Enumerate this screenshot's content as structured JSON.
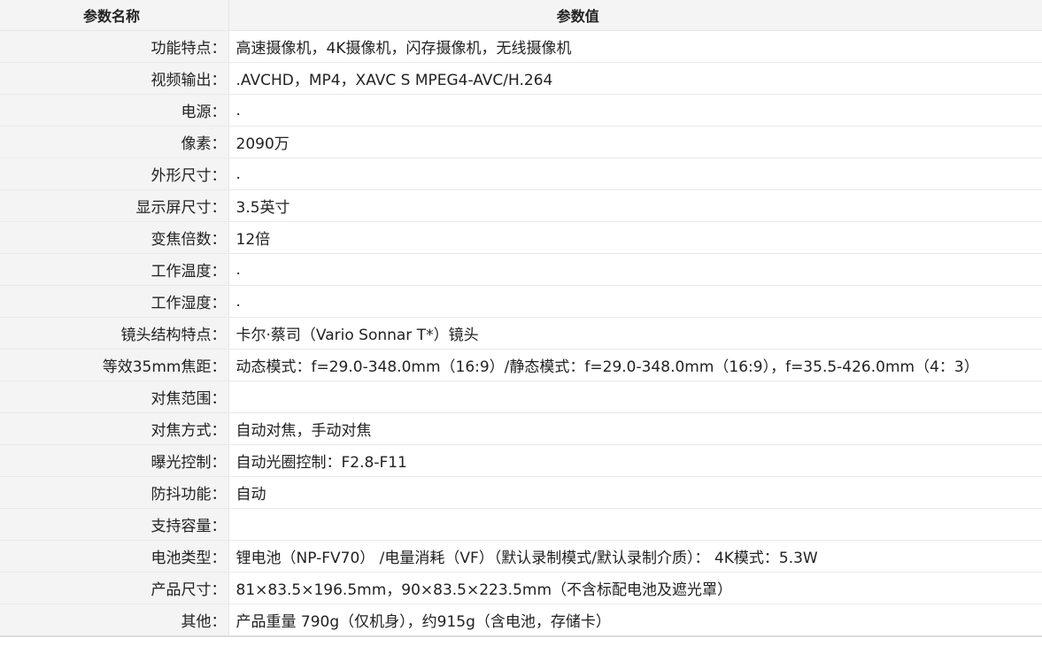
{
  "header": {
    "name_label": "参数名称",
    "value_label": "参数值"
  },
  "rows": [
    {
      "label": "功能特点：",
      "value": "高速摄像机，4K摄像机，闪存摄像机，无线摄像机"
    },
    {
      "label": "视频输出：",
      "value": ".AVCHD，MP4，XAVC S MPEG4-AVC/H.264"
    },
    {
      "label": "电源：",
      "value": "."
    },
    {
      "label": "像素：",
      "value": "2090万"
    },
    {
      "label": "外形尺寸：",
      "value": "."
    },
    {
      "label": "显示屏尺寸：",
      "value": "3.5英寸"
    },
    {
      "label": "变焦倍数：",
      "value": "12倍"
    },
    {
      "label": "工作温度：",
      "value": "."
    },
    {
      "label": "工作湿度：",
      "value": "."
    },
    {
      "label": "镜头结构特点：",
      "value": "卡尔·蔡司（Vario Sonnar T*）镜头"
    },
    {
      "label": "等效35mm焦距：",
      "value": "动态模式：f=29.0-348.0mm（16:9）/静态模式：f=29.0-348.0mm（16:9），f=35.5-426.0mm（4：3）"
    },
    {
      "label": "对焦范围：",
      "value": ""
    },
    {
      "label": "对焦方式：",
      "value": "自动对焦，手动对焦"
    },
    {
      "label": "曝光控制：",
      "value": "自动光圈控制：F2.8-F11"
    },
    {
      "label": "防抖功能：",
      "value": "自动"
    },
    {
      "label": "支持容量：",
      "value": ""
    },
    {
      "label": "电池类型：",
      "value": "锂电池（NP-FV70） /电量消耗（VF）（默认录制模式/默认录制介质）： 4K模式：5.3W"
    },
    {
      "label": "产品尺寸：",
      "value": "81×83.5×196.5mm，90×83.5×223.5mm（不含标配电池及遮光罩）"
    },
    {
      "label": "其他：",
      "value": "产品重量 790g（仅机身），约915g（含电池，存储卡）"
    }
  ]
}
